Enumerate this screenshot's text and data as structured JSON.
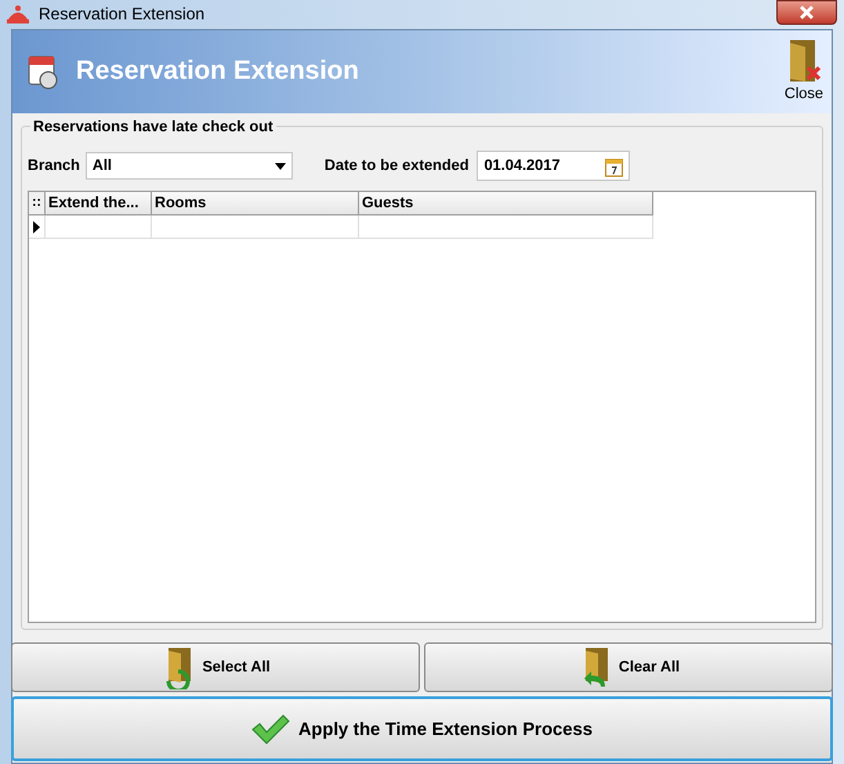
{
  "window": {
    "title": "Reservation Extension"
  },
  "header": {
    "title": "Reservation Extension",
    "close_label": "Close"
  },
  "group": {
    "title": "Reservations have late check out",
    "branch": {
      "label": "Branch",
      "value": "All"
    },
    "date": {
      "label": "Date to be extended",
      "value": "01.04.2017"
    }
  },
  "table": {
    "indicator": "::",
    "columns": [
      "Extend the...",
      "Rooms",
      "Guests"
    ],
    "rows": [
      {
        "current": true
      }
    ]
  },
  "buttons": [
    {
      "kind": "select",
      "label": "Select All"
    },
    {
      "kind": "clear",
      "label": "Clear All"
    }
  ],
  "apply_button": {
    "label": "Apply the Time Extension Process"
  }
}
